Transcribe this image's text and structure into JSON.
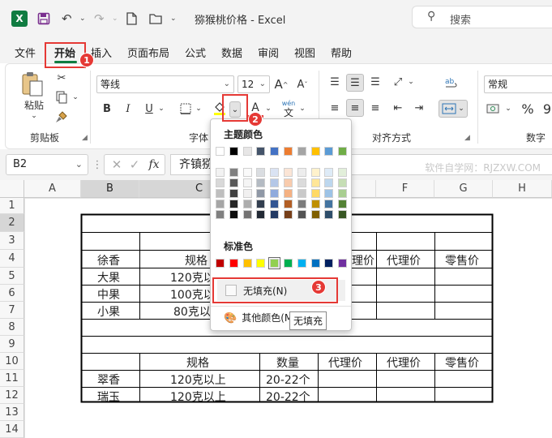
{
  "titlebar": {
    "title": "猕猴桃价格  -  Excel",
    "search_placeholder": "搜索"
  },
  "menu": [
    "文件",
    "开始",
    "插入",
    "页面布局",
    "公式",
    "数据",
    "审阅",
    "视图",
    "帮助"
  ],
  "ribbon": {
    "paste_label": "粘贴",
    "clipboard_label": "剪贴板",
    "font_name": "等线",
    "font_size": "12",
    "font_group_label": "字体",
    "align_group_label": "对齐方式",
    "number_format": "常规",
    "number_group_label": "数字",
    "wen_label": "wén",
    "wen_char": "文"
  },
  "formula_bar": {
    "name_box": "B2",
    "content": "齐镇猕",
    "watermark": "软件自学网：RJZXW.COM"
  },
  "columns": [
    "A",
    "B",
    "C",
    "D",
    "E",
    "F",
    "G",
    "H"
  ],
  "rows": [
    "1",
    "2",
    "3",
    "4",
    "5",
    "6",
    "7",
    "8",
    "9",
    "10",
    "11",
    "12",
    "13",
    "14"
  ],
  "cells": {
    "b4": "徐香",
    "c4": "规格",
    "e4": "理价",
    "f4": "代理价",
    "g4": "零售价",
    "b5": "大果",
    "c5": "120克以",
    "b6": "中果",
    "c6": "100克以",
    "b7": "小果",
    "c7": "80克以",
    "c10": "规格",
    "d10": "数量",
    "e10": "代理价",
    "f10": "代理价",
    "g10": "零售价",
    "b11": "翠香",
    "c11": "120克以上",
    "d11": "20-22个",
    "b12": "瑞玉",
    "c12": "120克以上",
    "d12": "20-22个"
  },
  "dropdown": {
    "theme_colors_label": "主题颜色",
    "standard_colors_label": "标准色",
    "no_fill_label": "无填充(N)",
    "more_colors_label": "其他颜色(M)...",
    "tooltip": "无填充"
  },
  "badges": [
    "1",
    "2",
    "3"
  ],
  "colors": {
    "accent": "#107c41",
    "callout": "#e53935",
    "theme_top": [
      "#ffffff",
      "#000000",
      "#e7e6e6",
      "#44546a",
      "#4472c4",
      "#ed7d31",
      "#a5a5a5",
      "#ffc000",
      "#5b9bd5",
      "#70ad47"
    ],
    "standard": [
      "#c00000",
      "#ff0000",
      "#ffc000",
      "#ffff00",
      "#92d050",
      "#00b050",
      "#00b0f0",
      "#0070c0",
      "#002060",
      "#7030a0"
    ]
  }
}
